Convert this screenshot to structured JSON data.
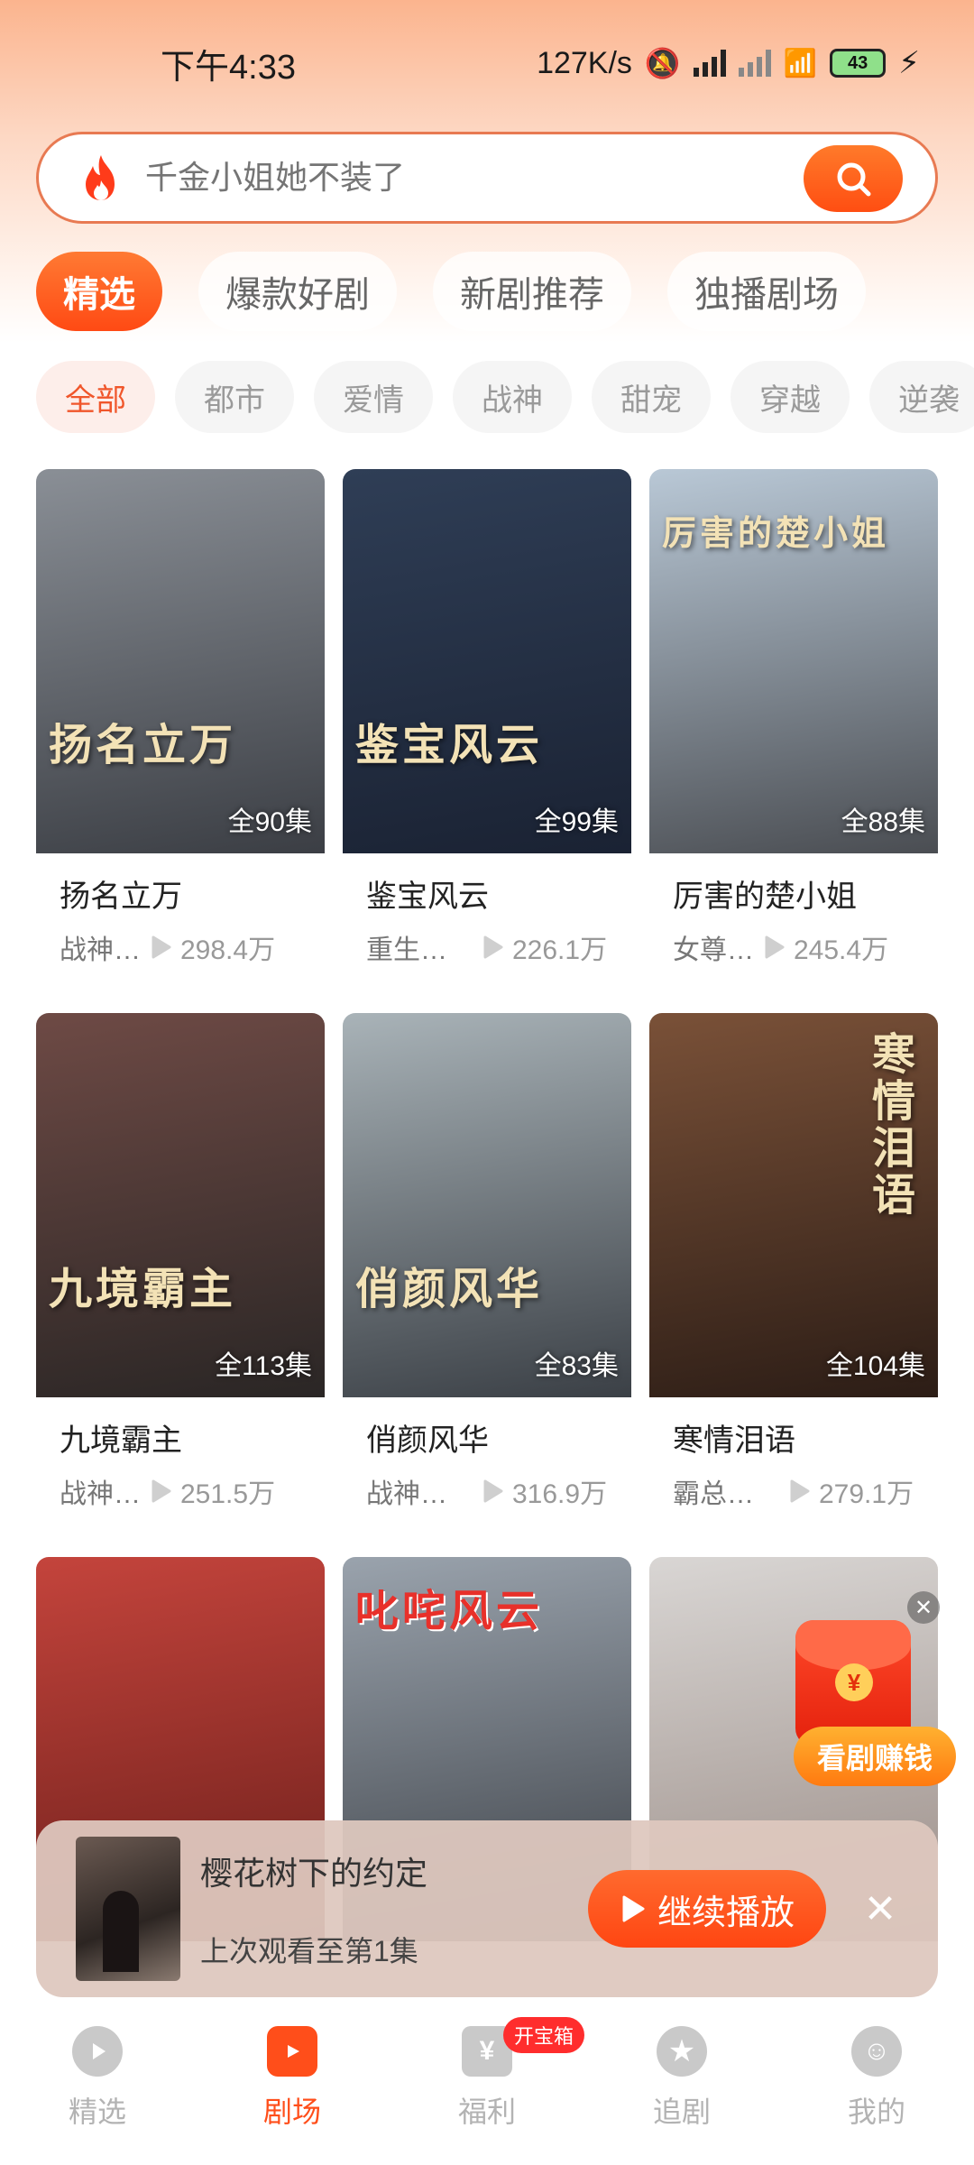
{
  "status_bar": {
    "time": "下午4:33",
    "speed": "127K/s",
    "battery": "43"
  },
  "search": {
    "placeholder": "千金小姐她不装了"
  },
  "main_tabs": [
    {
      "label": "精选",
      "active": true
    },
    {
      "label": "爆款好剧"
    },
    {
      "label": "新剧推荐"
    },
    {
      "label": "独播剧场"
    }
  ],
  "categories": [
    {
      "label": "全部",
      "active": true
    },
    {
      "label": "都市"
    },
    {
      "label": "爱情"
    },
    {
      "label": "战神"
    },
    {
      "label": "甜宠"
    },
    {
      "label": "穿越"
    },
    {
      "label": "逆袭"
    }
  ],
  "dramas": [
    {
      "title": "扬名立万",
      "poster_text": "扬名立万",
      "episodes": "全90集",
      "genre": "战神…",
      "views": "298.4万",
      "colors": [
        "#8a8f96",
        "#3b3e44"
      ]
    },
    {
      "title": "鉴宝风云",
      "poster_text": "鉴宝风云",
      "episodes": "全99集",
      "genre": "重生归来",
      "views": "226.1万",
      "colors": [
        "#2f3e56",
        "#1a2233"
      ]
    },
    {
      "title": "厉害的楚小姐",
      "poster_text": "厉害的楚小姐",
      "episodes": "全88集",
      "genre": "女尊…",
      "views": "245.4万",
      "colors": [
        "#b9c8d6",
        "#4a4d52"
      ]
    },
    {
      "title": "九境霸主",
      "poster_text": "九境霸主",
      "episodes": "全113集",
      "genre": "战神…",
      "views": "251.5万",
      "colors": [
        "#6e4a45",
        "#2a2625"
      ]
    },
    {
      "title": "俏颜风华",
      "poster_text": "俏颜风华",
      "episodes": "全83集",
      "genre": "战神归来",
      "views": "316.9万",
      "colors": [
        "#a9b3b8",
        "#3b4046"
      ]
    },
    {
      "title": "寒情泪语",
      "poster_text": "寒情泪语",
      "episodes": "全104集",
      "genre": "霸总追妻",
      "views": "279.1万",
      "colors": [
        "#7a5138",
        "#2c1d16"
      ]
    },
    {
      "title": "",
      "poster_text": "",
      "episodes": "",
      "genre": "",
      "views": "",
      "colors": [
        "#c4443c",
        "#6a1e1a"
      ]
    },
    {
      "title": "",
      "poster_text": "叱咤风云",
      "episodes": "",
      "genre": "",
      "views": "",
      "colors": [
        "#9aa3ad",
        "#3b3f45"
      ]
    },
    {
      "title": "",
      "poster_text": "",
      "episodes": "",
      "genre": "",
      "views": "",
      "colors": [
        "#d9d6d4",
        "#9a8c86"
      ]
    }
  ],
  "promo": {
    "label": "看剧赚钱",
    "coin": "¥"
  },
  "continue": {
    "title": "樱花树下的约定",
    "subtitle": "上次观看至第1集",
    "button": "继续播放"
  },
  "bottom_nav": [
    {
      "label": "精选"
    },
    {
      "label": "剧场",
      "active": true
    },
    {
      "label": "福利",
      "badge": "开宝箱"
    },
    {
      "label": "追剧"
    },
    {
      "label": "我的"
    }
  ],
  "accent_color": "#ff4e1a"
}
